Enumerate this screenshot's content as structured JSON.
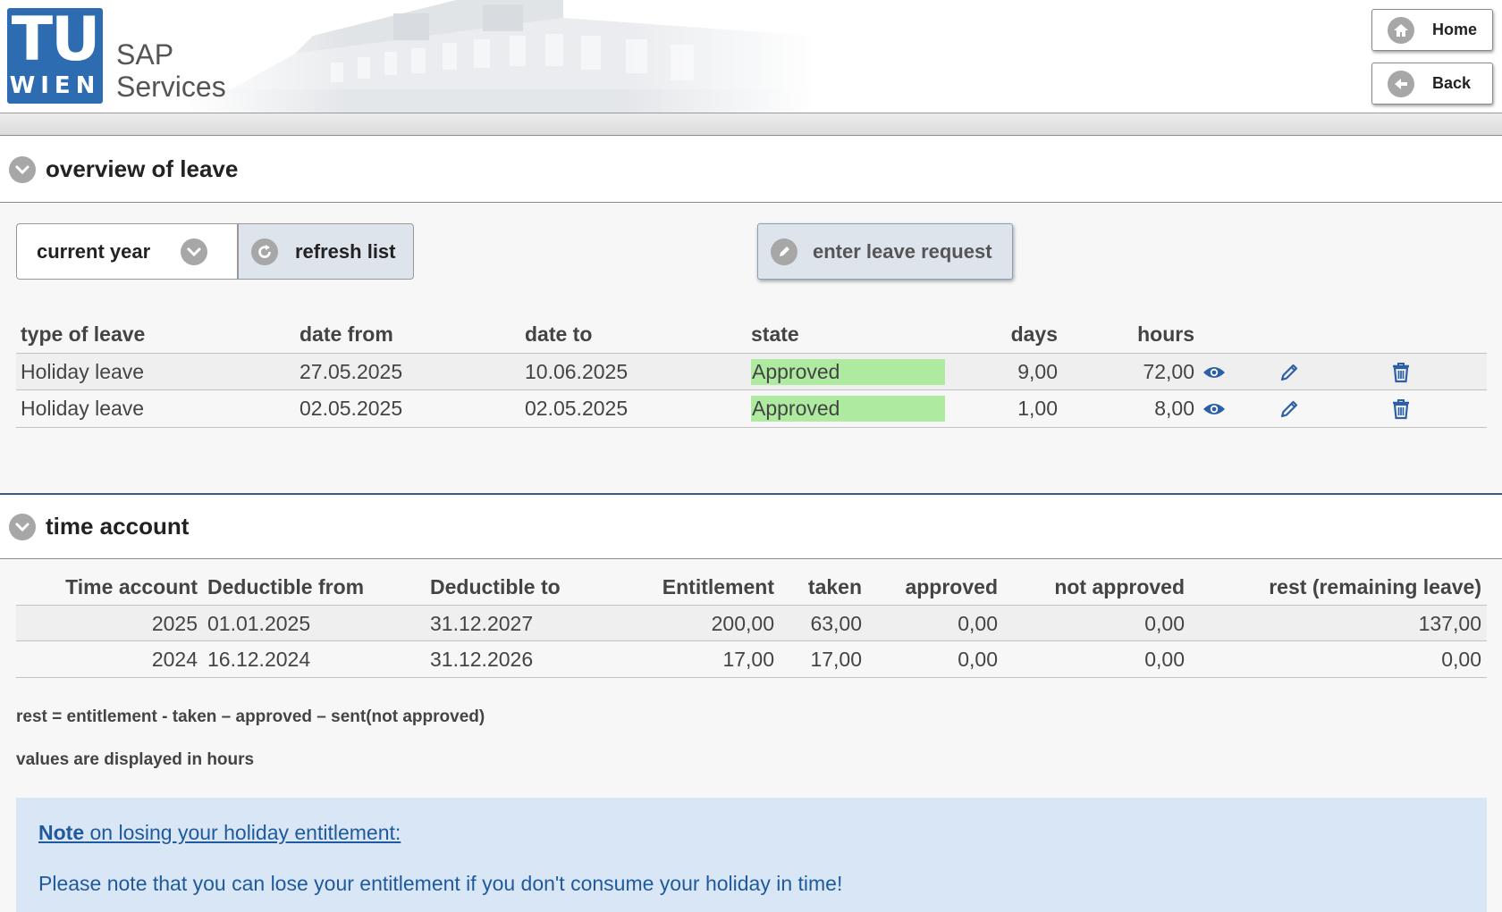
{
  "header": {
    "logo_tu": "TU",
    "logo_wien": "WIEN",
    "app_line1": "SAP",
    "app_line2": "Services",
    "home_label": "Home",
    "back_label": "Back"
  },
  "overview": {
    "title": "overview of leave",
    "year_select": "current year",
    "refresh_label": "refresh list",
    "enter_label": "enter leave request",
    "columns": [
      "type of leave",
      "date from",
      "date to",
      "state",
      "days",
      "hours"
    ],
    "rows": [
      {
        "type": "Holiday leave",
        "from": "27.05.2025",
        "to": "10.06.2025",
        "state": "Approved",
        "days": "9,00",
        "hours": "72,00"
      },
      {
        "type": "Holiday leave",
        "from": "02.05.2025",
        "to": "02.05.2025",
        "state": "Approved",
        "days": "1,00",
        "hours": "8,00"
      }
    ]
  },
  "time_account": {
    "title": "time account",
    "columns": [
      "Time account",
      "Deductible from",
      "Deductible to",
      "Entitlement",
      "taken",
      "approved",
      "not approved",
      "rest (remaining leave)"
    ],
    "rows": [
      {
        "account": "2025",
        "from": "01.01.2025",
        "to": "31.12.2027",
        "entitlement": "200,00",
        "taken": "63,00",
        "approved": "0,00",
        "not_approved": "0,00",
        "rest": "137,00"
      },
      {
        "account": "2024",
        "from": "16.12.2024",
        "to": "31.12.2026",
        "entitlement": "17,00",
        "taken": "17,00",
        "approved": "0,00",
        "not_approved": "0,00",
        "rest": "0,00"
      }
    ],
    "formula": "rest = entitlement - taken – approved – sent(not approved)",
    "units_note": "values are displayed in hours"
  },
  "info": {
    "title_bold": "Note",
    "title_rest": " on losing your holiday entitlement:",
    "text": "Please note that you can lose your entitlement if you don't consume your holiday in time!"
  },
  "colors": {
    "brand_blue": "#2d6cb0",
    "approved_green": "#aeeaa0",
    "info_bg": "#d9e6f5",
    "link_blue": "#1f5a9c",
    "icon_blue": "#2b5fa6"
  },
  "icons": {
    "home": "home-icon",
    "back": "arrow-left-icon",
    "collapse": "chevron-down-icon",
    "refresh": "refresh-icon",
    "edit": "pencil-icon",
    "view": "eye-icon",
    "delete": "trash-icon"
  }
}
